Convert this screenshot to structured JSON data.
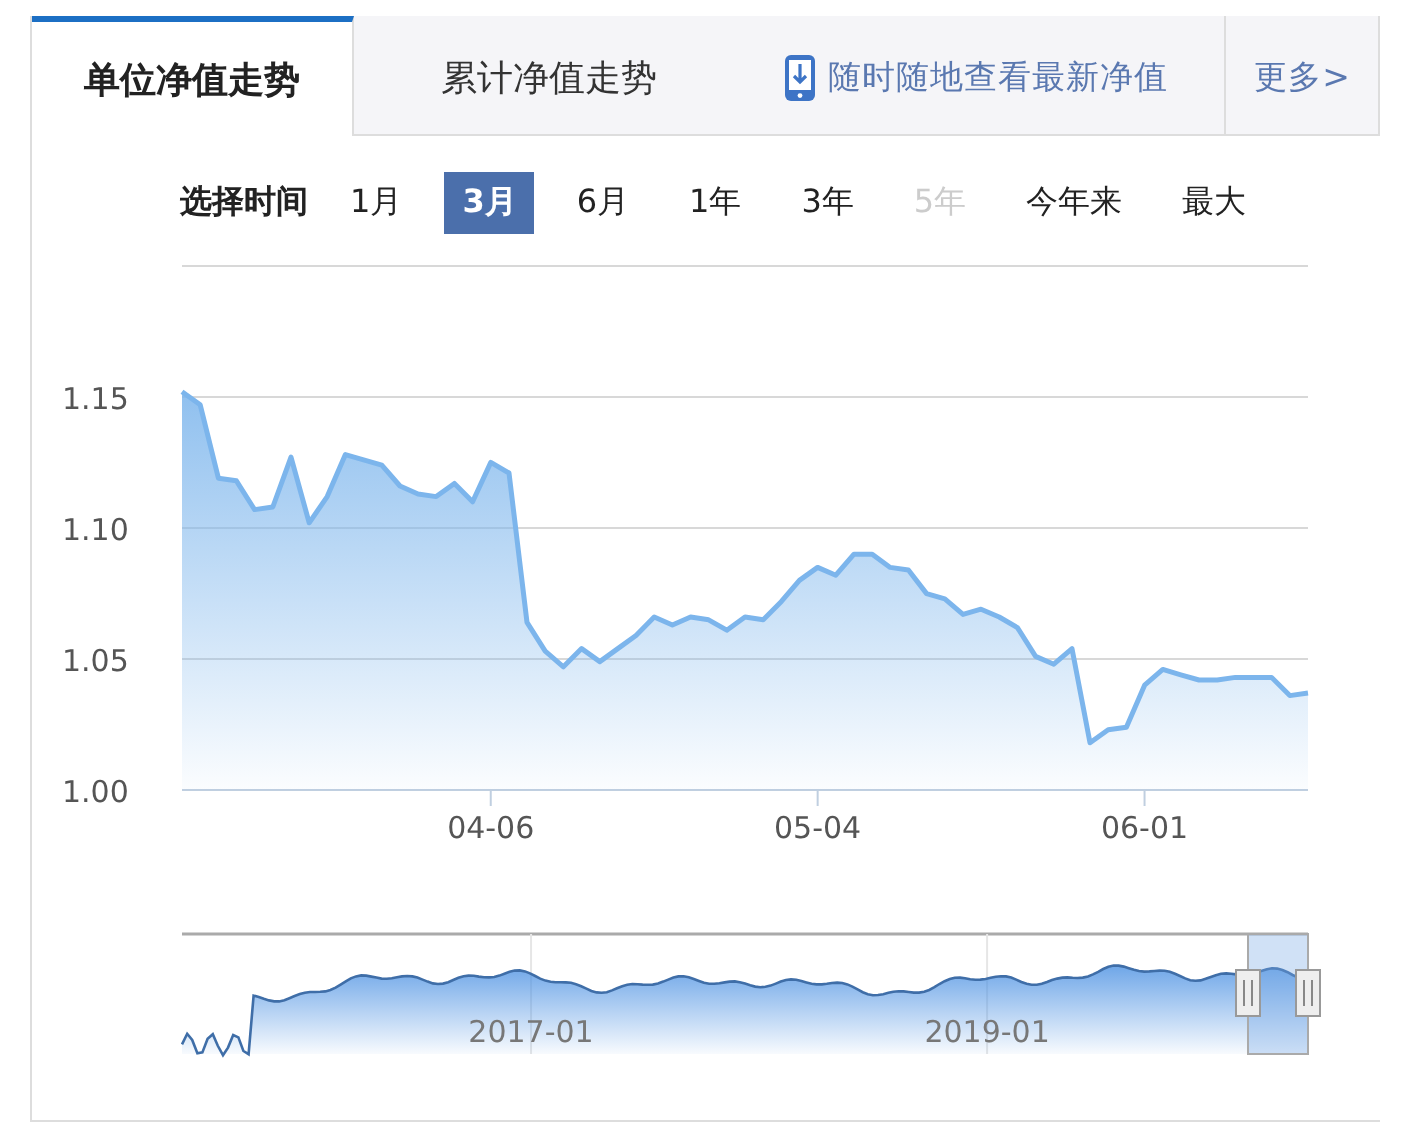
{
  "tabs": [
    {
      "label": "单位净值走势",
      "selected": true
    },
    {
      "label": "累计净值走势",
      "selected": false
    }
  ],
  "app_link": "随时随地查看最新净值",
  "more_link": "更多>",
  "time_selector": {
    "label": "选择时间",
    "options": [
      {
        "label": "1月",
        "selected": false,
        "disabled": false
      },
      {
        "label": "3月",
        "selected": true,
        "disabled": false
      },
      {
        "label": "6月",
        "selected": false,
        "disabled": false
      },
      {
        "label": "1年",
        "selected": false,
        "disabled": false
      },
      {
        "label": "3年",
        "selected": false,
        "disabled": false
      },
      {
        "label": "5年",
        "selected": false,
        "disabled": true
      },
      {
        "label": "今年来",
        "selected": false,
        "disabled": false
      },
      {
        "label": "最大",
        "selected": false,
        "disabled": false
      }
    ]
  },
  "chart_data": {
    "type": "area",
    "categories": [
      null,
      null,
      null,
      null,
      null,
      null,
      null,
      null,
      null,
      null,
      null,
      null,
      null,
      null,
      null,
      null,
      null,
      "04-06",
      null,
      null,
      null,
      null,
      null,
      null,
      null,
      null,
      null,
      null,
      null,
      null,
      null,
      null,
      null,
      null,
      null,
      "05-04",
      null,
      null,
      null,
      null,
      null,
      null,
      null,
      null,
      null,
      null,
      null,
      null,
      null,
      null,
      null,
      null,
      null,
      "06-01",
      null,
      null,
      null,
      null,
      null,
      null,
      null,
      null,
      null
    ],
    "series": [
      {
        "color": "#7cb5ec",
        "values": [
          1.152,
          1.147,
          1.119,
          1.118,
          1.107,
          1.108,
          1.127,
          1.102,
          1.112,
          1.128,
          1.126,
          1.124,
          1.116,
          1.113,
          1.112,
          1.117,
          1.11,
          1.125,
          1.121,
          1.064,
          1.053,
          1.047,
          1.054,
          1.049,
          1.054,
          1.059,
          1.066,
          1.063,
          1.066,
          1.065,
          1.061,
          1.066,
          1.065,
          1.072,
          1.08,
          1.085,
          1.082,
          1.09,
          1.09,
          1.085,
          1.084,
          1.075,
          1.073,
          1.067,
          1.069,
          1.066,
          1.062,
          1.051,
          1.048,
          1.054,
          1.018,
          1.023,
          1.024,
          1.04,
          1.046,
          1.044,
          1.042,
          1.042,
          1.043,
          1.043,
          1.043,
          1.036,
          1.037
        ]
      }
    ],
    "ylim": [
      1.0,
      1.2
    ],
    "grid": true,
    "yticks": [
      {
        "value": 1.0,
        "label": "1.00"
      },
      {
        "value": 1.05,
        "label": "1.05"
      },
      {
        "value": 1.1,
        "label": "1.10"
      },
      {
        "value": 1.15,
        "label": "1.15"
      }
    ]
  },
  "navigator": {
    "labels": [
      "2017-01",
      "2019-01"
    ]
  }
}
